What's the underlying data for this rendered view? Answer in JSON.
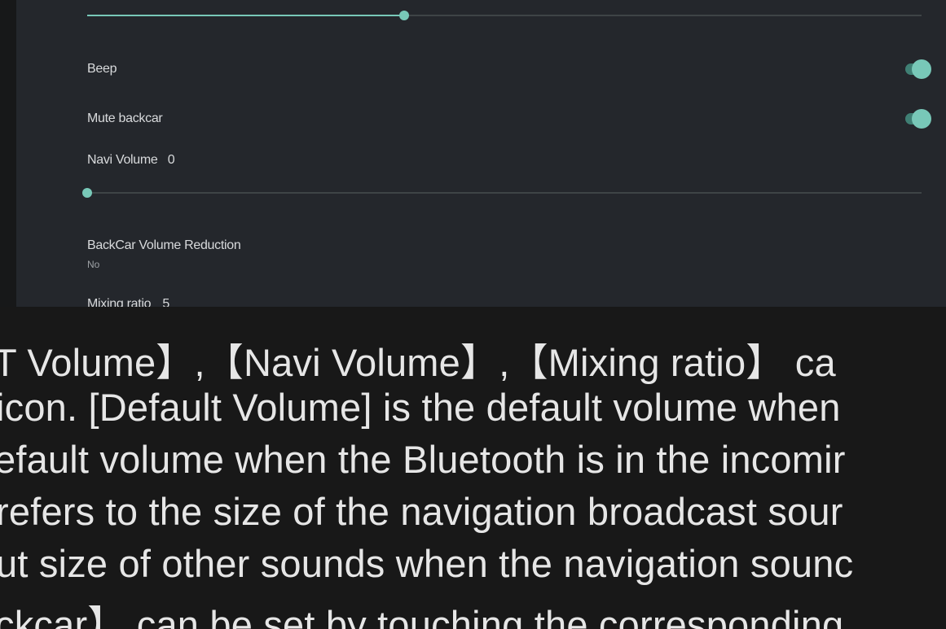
{
  "settings": {
    "beep_label": "Beep",
    "mute_backcar_label": "Mute backcar",
    "navi_volume": {
      "label": "Navi Volume",
      "value": "0"
    },
    "backcar_reduction": {
      "label": "BackCar Volume Reduction",
      "value": "No"
    },
    "mixing_ratio": {
      "label": "Mixing ratio",
      "value": "5"
    },
    "top_slider_fraction": 0.38,
    "navi_slider_fraction": 0.0,
    "beep_on": true,
    "mute_backcar_on": true,
    "accent": "#78c8b8"
  },
  "doc": {
    "lines": [
      "T Volume】,【Navi Volume】,【Mixing ratio】 ca",
      "icon. [Default Volume] is the default volume when",
      "efault volume when the Bluetooth is in the incomir",
      " refers to the size of the navigation broadcast sour",
      "ut size of other sounds when the navigation sounc",
      "ckcar】 can be set by touching the corresponding"
    ]
  }
}
